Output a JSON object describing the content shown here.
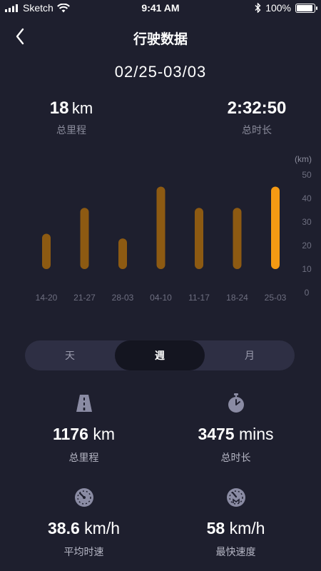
{
  "status_bar": {
    "carrier": "Sketch",
    "time": "9:41 AM",
    "battery": "100%",
    "battery_level": 1.0
  },
  "nav": {
    "title": "行驶数据"
  },
  "date_range": "02/25-03/03",
  "summary": {
    "distance": {
      "value": "18",
      "unit": "km",
      "label": "总里程"
    },
    "duration": {
      "value": "2:32:50",
      "label": "总时长"
    }
  },
  "chart_data": {
    "type": "bar",
    "categories": [
      "14-20",
      "21-27",
      "28-03",
      "04-10",
      "11-17",
      "18-24",
      "25-03"
    ],
    "values": [
      25,
      36,
      23,
      45,
      36,
      36,
      45
    ],
    "ylabel": "(km)",
    "ylim": [
      0,
      50
    ],
    "yticks": [
      0,
      10,
      20,
      30,
      40,
      50
    ],
    "base_value": 10,
    "bar_color": "#8d5a12",
    "highlight_color": "#f59a13",
    "highlight_index": 6,
    "grid": false
  },
  "tabs": [
    {
      "label": "天",
      "active": false
    },
    {
      "label": "週",
      "active": true
    },
    {
      "label": "月",
      "active": false
    }
  ],
  "stats": {
    "total_distance": {
      "value": "1176",
      "unit": "km",
      "label": "总里程",
      "icon": "road-icon"
    },
    "total_time": {
      "value": "3475",
      "unit": "mins",
      "label": "总时长",
      "icon": "stopwatch-icon"
    },
    "avg_speed": {
      "value": "38.6",
      "unit": "km/h",
      "label": "平均时速",
      "icon": "speedometer-icon"
    },
    "max_speed": {
      "value": "58",
      "unit": "km/h",
      "label": "最快速度",
      "icon": "max-speed-icon"
    }
  },
  "colors": {
    "background": "#1e1f2e",
    "accent": "#f59a13",
    "muted": "#8b8c9c",
    "tab_bg": "#2e2f44",
    "icon": "#8a8ba3"
  }
}
